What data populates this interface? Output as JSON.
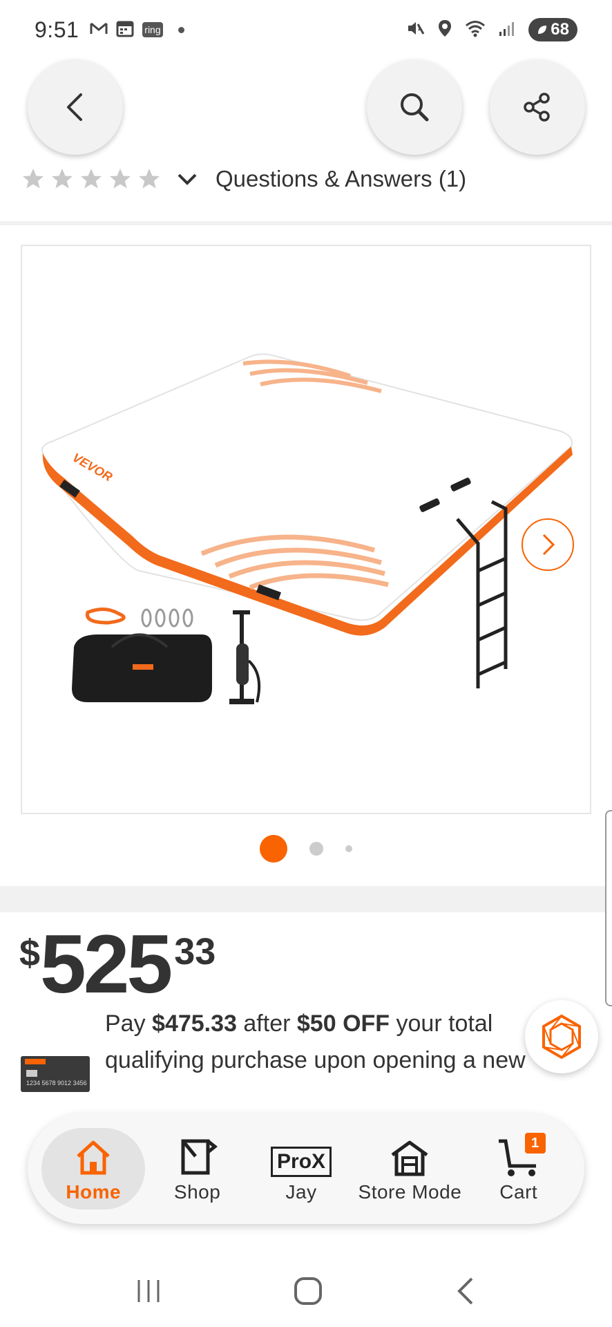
{
  "status_bar": {
    "time": "9:51",
    "left_icons": [
      "gmail-icon",
      "calendar-icon",
      "ring-icon",
      "dot-icon"
    ],
    "ring_label": "ring",
    "right_icons": [
      "mute-icon",
      "location-icon",
      "wifi-icon",
      "signal-icon"
    ],
    "battery": "68"
  },
  "header": {
    "back_icon": "chevron-left-icon",
    "search_icon": "search-icon",
    "share_icon": "share-icon"
  },
  "rating": {
    "stars": 5,
    "questions_label": "Questions & Answers (1)"
  },
  "gallery": {
    "product_brand_text": "VEVOR",
    "current_index": 1,
    "total_images": 3
  },
  "price": {
    "currency": "$",
    "dollars": "525",
    "cents": "33"
  },
  "promo": {
    "pay_text": "Pay ",
    "pay_amount": "$475.33",
    "after_text": " after ",
    "discount": "$50 OFF",
    "rest_text": " your total qualifying purchase upon opening a new",
    "card_number": "1234 5678 9012 3456"
  },
  "bottom_nav": {
    "items": [
      {
        "label": "Home",
        "icon": "home-icon",
        "active": true
      },
      {
        "label": "Shop",
        "icon": "shop-icon",
        "active": false
      },
      {
        "label": "Jay",
        "icon": "prox-icon",
        "icon_text": "ProX",
        "active": false
      },
      {
        "label": "Store Mode",
        "icon": "store-icon",
        "active": false
      },
      {
        "label": "Cart",
        "icon": "cart-icon",
        "badge": "1",
        "active": false
      }
    ]
  },
  "system_nav": [
    "recents-icon",
    "home-circle-icon",
    "back-icon"
  ],
  "colors": {
    "accent": "#f96302",
    "text": "#333333",
    "divider": "#f1f1f1"
  }
}
